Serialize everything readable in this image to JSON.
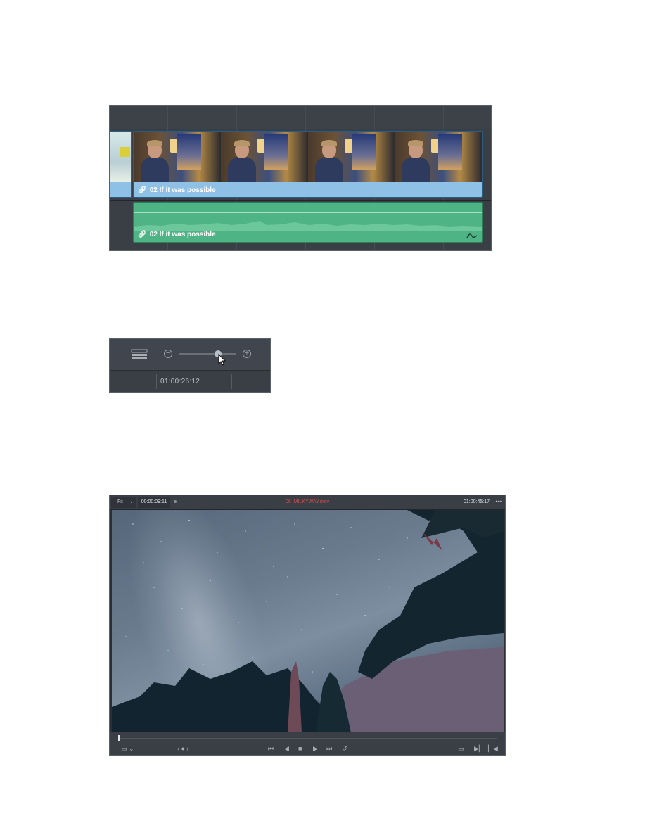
{
  "timeline": {
    "video_clip": {
      "name": "02 If it was possible",
      "icon": "link-icon"
    },
    "audio_clip": {
      "name": "02 If it was possible",
      "icon": "link-icon",
      "keyframe_icon": "keyframe-curve-icon"
    },
    "colors": {
      "video_clip": "#8fc1e6",
      "audio_clip": "#4fb485",
      "playhead": "#c0333a"
    }
  },
  "zoom_control": {
    "view_icon": "timeline-view-options-icon",
    "minus_icon": "zoom-out-icon",
    "plus_icon": "zoom-in-icon",
    "zoom_level": 0.68,
    "timecode": "01:00:26:12"
  },
  "viewer": {
    "zoom_menu": "Fit",
    "source_timecode": "00:00:09:11",
    "clip_name": "06_MILKYWAY.mov",
    "record_timecode": "01:00:45:17",
    "more_icon": "more-options-icon",
    "playhead_position": 0.0,
    "transport": [
      "jump-to-start-icon",
      "play-reverse-icon",
      "stop-icon",
      "play-icon",
      "jump-to-end-icon",
      "loop-icon"
    ],
    "colors": {
      "clip_name": "#d94a4a"
    }
  }
}
